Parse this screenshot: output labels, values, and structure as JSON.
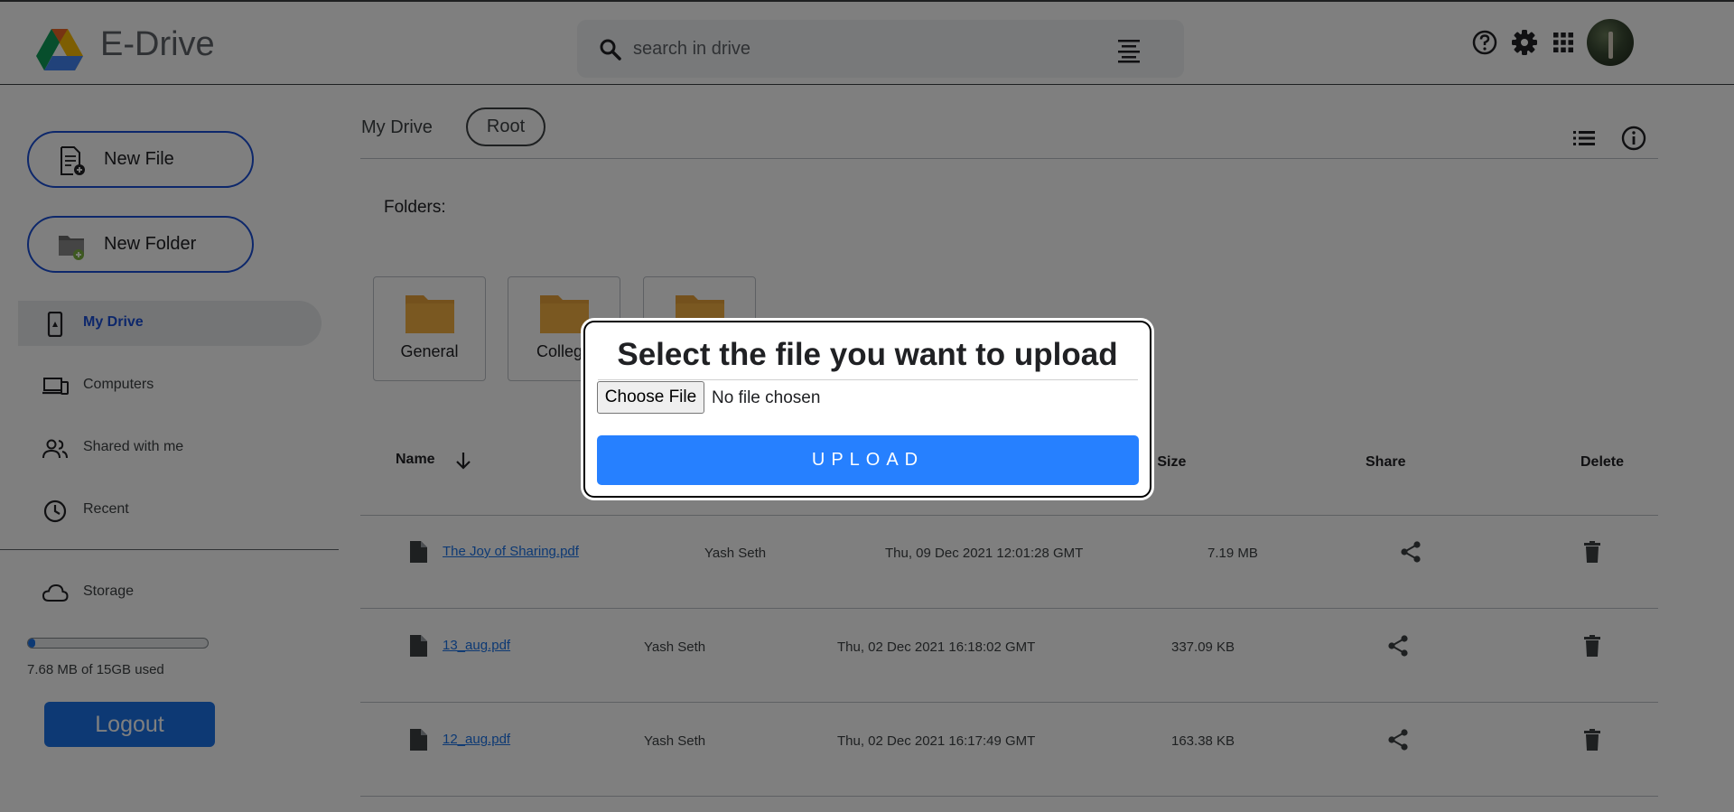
{
  "header": {
    "brand": "E-Drive",
    "search_placeholder": "search in drive"
  },
  "sidebar": {
    "new_file_label": "New File",
    "new_folder_label": "New Folder",
    "nav": [
      {
        "label": "My Drive",
        "active": true,
        "icon": "phone-drive-icon"
      },
      {
        "label": "Computers",
        "active": false,
        "icon": "computers-icon"
      },
      {
        "label": "Shared with me",
        "active": false,
        "icon": "people-icon"
      },
      {
        "label": "Recent",
        "active": false,
        "icon": "clock-icon"
      }
    ],
    "storage_label": "Storage",
    "storage_used_text": "7.68 MB of 15GB used",
    "storage_fraction": 0.0005,
    "logout_label": "Logout"
  },
  "main": {
    "breadcrumb_mydrive": "My Drive",
    "breadcrumb_root": "Root",
    "folders_label": "Folders:",
    "folders": [
      "General",
      "College",
      ""
    ],
    "columns": {
      "name": "Name",
      "size": "e Size",
      "share": "Share",
      "delete": "Delete"
    },
    "files": [
      {
        "name": "The Joy of Sharing.pdf",
        "owner": "Yash Seth",
        "modified": "Thu, 09 Dec 2021 12:01:28 GMT",
        "size": "7.19 MB"
      },
      {
        "name": "13_aug.pdf",
        "owner": "Yash Seth",
        "modified": "Thu, 02 Dec 2021 16:18:02 GMT",
        "size": "337.09 KB"
      },
      {
        "name": "12_aug.pdf",
        "owner": "Yash Seth",
        "modified": "Thu, 02 Dec 2021 16:17:49 GMT",
        "size": "163.38 KB"
      }
    ]
  },
  "modal": {
    "title": "Select the file you want to upload",
    "choose_label": "Choose File",
    "no_file_text": "No file chosen",
    "upload_label": "UPLOAD"
  },
  "colors": {
    "accent": "#1a73e8",
    "upload_button": "#2680ff",
    "outline_blue": "#1a4fd6",
    "folder": "#f5a623"
  }
}
